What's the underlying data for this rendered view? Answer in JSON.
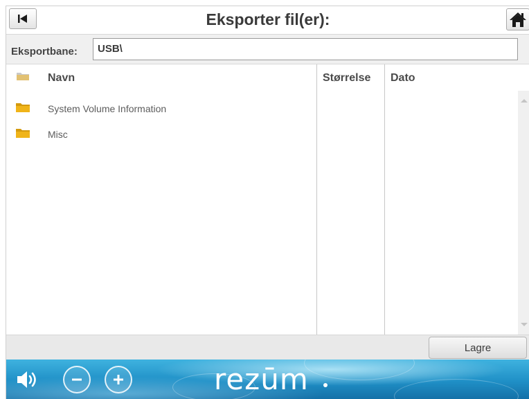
{
  "header": {
    "title": "Eksporter fil(er):",
    "back_icon": "back-to-start-icon",
    "home_icon": "home-icon"
  },
  "export_path": {
    "label": "Eksportbane:",
    "value": "USB\\"
  },
  "file_list": {
    "columns": [
      "Navn",
      "Størrelse",
      "Dato"
    ],
    "rows": [
      {
        "name": "System Volume Information",
        "size": "",
        "date": "",
        "icon": "folder-icon"
      },
      {
        "name": "Misc",
        "size": "",
        "date": "",
        "icon": "folder-icon"
      }
    ]
  },
  "actions": {
    "save_label": "Lagre"
  },
  "footer": {
    "brand": "rezūm",
    "volume_icon": "speaker-icon",
    "decrease_icon": "minus-icon",
    "increase_icon": "plus-icon"
  },
  "colors": {
    "folder": "#f0b419",
    "footer_blue": "#1f8fc6",
    "text": "#3a3a3a"
  }
}
